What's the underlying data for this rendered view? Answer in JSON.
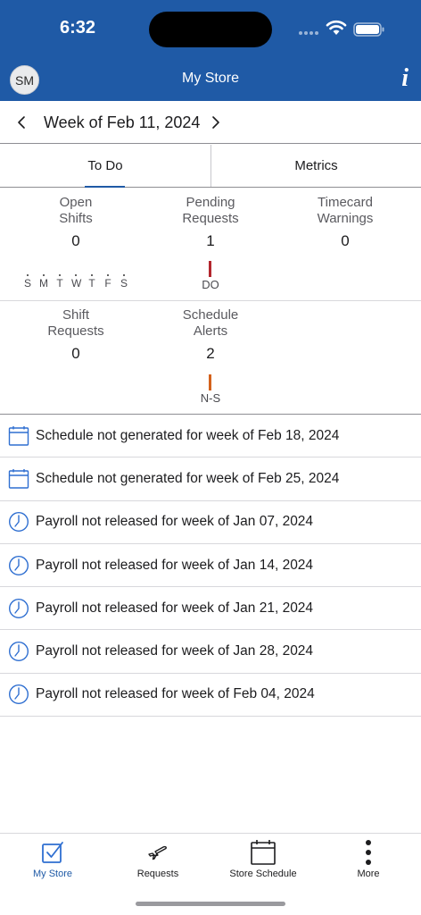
{
  "status_bar": {
    "time": "6:32"
  },
  "header": {
    "avatar_initials": "SM",
    "title": "My Store",
    "info_label": "i"
  },
  "week": {
    "label": "Week of Feb 11, 2024"
  },
  "tabs": [
    {
      "label": "To Do",
      "active": true
    },
    {
      "label": "Metrics",
      "active": false
    }
  ],
  "summary": {
    "open_shifts": {
      "label_line1": "Open",
      "label_line2": "Shifts",
      "count": "0",
      "days": [
        "S",
        "M",
        "T",
        "W",
        "T",
        "F",
        "S"
      ]
    },
    "pending_requests": {
      "label_line1": "Pending",
      "label_line2": "Requests",
      "count": "1",
      "marker_label": "DO",
      "marker_color": "#b3262e"
    },
    "timecard_warnings": {
      "label_line1": "Timecard",
      "label_line2": "Warnings",
      "count": "0"
    },
    "shift_requests": {
      "label_line1": "Shift",
      "label_line2": "Requests",
      "count": "0"
    },
    "schedule_alerts": {
      "label_line1": "Schedule",
      "label_line2": "Alerts",
      "count": "2",
      "marker_label": "N-S",
      "marker_color": "#d4621c"
    }
  },
  "alerts": [
    {
      "icon": "calendar-icon",
      "text": "Schedule not generated for week of Feb 18, 2024"
    },
    {
      "icon": "calendar-icon",
      "text": "Schedule not generated for week of Feb 25, 2024"
    },
    {
      "icon": "clock-icon",
      "text": "Payroll not released for week of Jan 07, 2024"
    },
    {
      "icon": "clock-icon",
      "text": "Payroll not released for week of Jan 14, 2024"
    },
    {
      "icon": "clock-icon",
      "text": "Payroll not released for week of Jan 21, 2024"
    },
    {
      "icon": "clock-icon",
      "text": "Payroll not released for week of Jan 28, 2024"
    },
    {
      "icon": "clock-icon",
      "text": "Payroll not released for week of Feb 04, 2024"
    }
  ],
  "tab_bar": [
    {
      "label": "My Store",
      "icon": "checkbox-icon",
      "active": true
    },
    {
      "label": "Requests",
      "icon": "airplane-icon",
      "active": false
    },
    {
      "label": "Store Schedule",
      "icon": "calendar-icon",
      "active": false
    },
    {
      "label": "More",
      "icon": "more-vertical-icon",
      "active": false
    }
  ],
  "colors": {
    "brand": "#1f5aa6",
    "accent": "#2f6fd1"
  }
}
